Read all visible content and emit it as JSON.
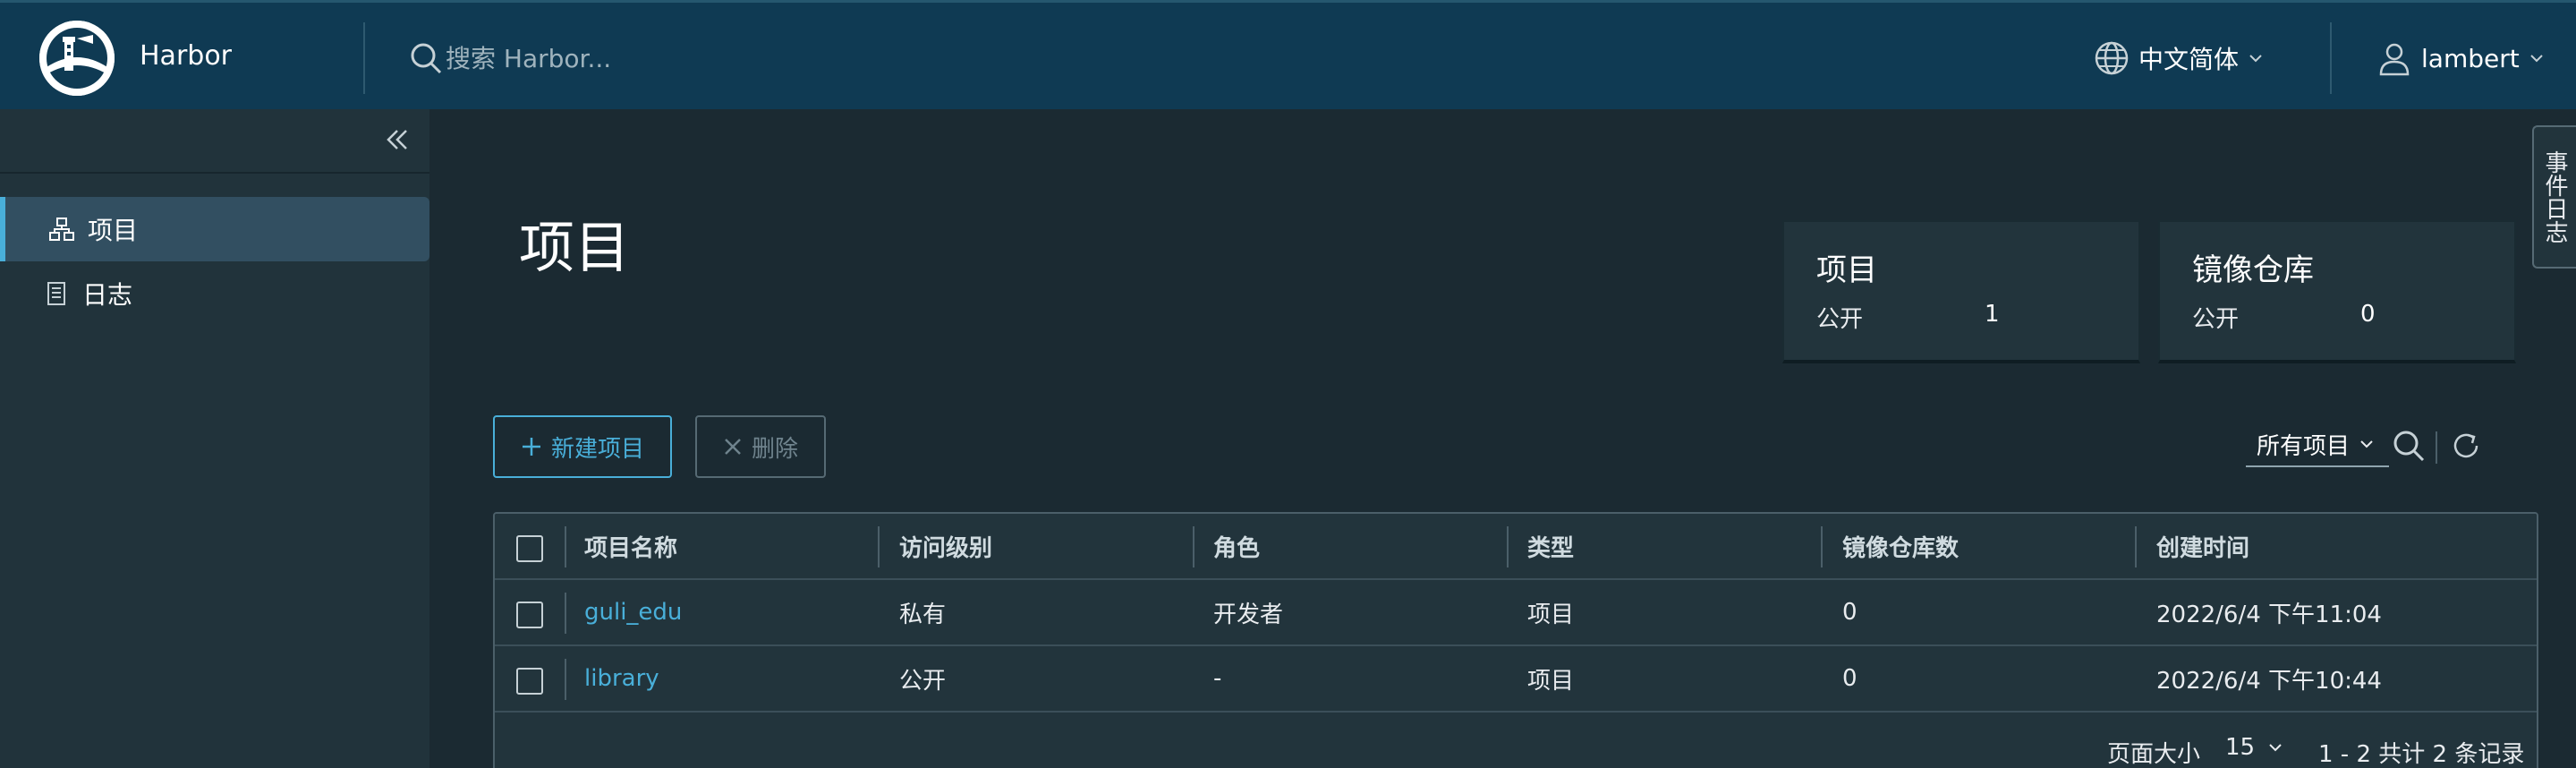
{
  "header": {
    "brand": "Harbor",
    "search_placeholder": "搜索 Harbor...",
    "language": "中文简体",
    "username": "lambert"
  },
  "sidebar": {
    "items": [
      {
        "label": "项目",
        "icon": "projects-icon",
        "active": true
      },
      {
        "label": "日志",
        "icon": "logs-icon",
        "active": false
      }
    ]
  },
  "main": {
    "title": "项目",
    "summary": [
      {
        "title": "项目",
        "label": "公开",
        "count": "1"
      },
      {
        "title": "镜像仓库",
        "label": "公开",
        "count": "0"
      }
    ],
    "new_button": "新建项目",
    "delete_button": "删除",
    "filter_label": "所有项目"
  },
  "table": {
    "headers": [
      "项目名称",
      "访问级别",
      "角色",
      "类型",
      "镜像仓库数",
      "创建时间"
    ],
    "rows": [
      [
        "guli_edu",
        "私有",
        "开发者",
        "项目",
        "0",
        "2022/6/4 下午11:04"
      ],
      [
        "library",
        "公开",
        "-",
        "项目",
        "0",
        "2022/6/4 下午10:44"
      ]
    ],
    "footer": {
      "page_size_label": "页面大小",
      "page_size": "15",
      "summary": "1 - 2 共计 2 条记录"
    }
  },
  "event_tab": "事件日志",
  "colors": {
    "header_bg": "#0f3a53",
    "sidebar_bg": "#21333b",
    "content_bg": "#1b2a32",
    "accent": "#49afd9"
  }
}
